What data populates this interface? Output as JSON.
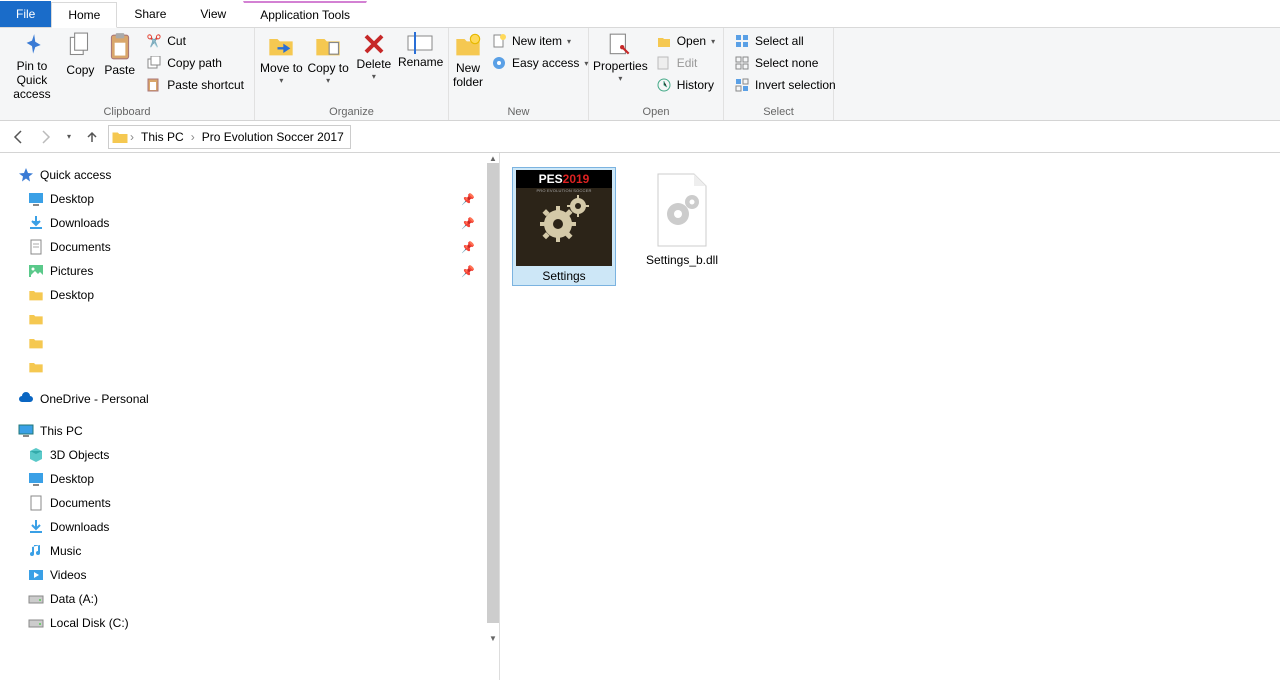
{
  "tabs": {
    "file": "File",
    "home": "Home",
    "share": "Share",
    "view": "View",
    "app_tools": "Application Tools"
  },
  "ribbon": {
    "clipboard": {
      "title": "Clipboard",
      "pin": "Pin to Quick access",
      "copy": "Copy",
      "paste": "Paste",
      "cut": "Cut",
      "copy_path": "Copy path",
      "paste_shortcut": "Paste shortcut"
    },
    "organize": {
      "title": "Organize",
      "move_to": "Move to",
      "copy_to": "Copy to",
      "delete": "Delete",
      "rename": "Rename"
    },
    "new": {
      "title": "New",
      "new_folder": "New folder",
      "new_item": "New item",
      "easy_access": "Easy access"
    },
    "open": {
      "title": "Open",
      "properties": "Properties",
      "open": "Open",
      "edit": "Edit",
      "history": "History"
    },
    "select": {
      "title": "Select",
      "select_all": "Select all",
      "select_none": "Select none",
      "invert": "Invert selection"
    }
  },
  "breadcrumb": {
    "root": "This PC",
    "folder": "Pro Evolution Soccer 2017"
  },
  "sidebar": {
    "quick_access": "Quick access",
    "desktop": "Desktop",
    "downloads": "Downloads",
    "documents": "Documents",
    "pictures": "Pictures",
    "desktop2": "Desktop",
    "onedrive": "OneDrive - Personal",
    "this_pc": "This PC",
    "objects3d": "3D Objects",
    "desktop3": "Desktop",
    "documents2": "Documents",
    "downloads2": "Downloads",
    "music": "Music",
    "videos": "Videos",
    "data_a": "Data (A:)",
    "local_c": "Local Disk (C:)"
  },
  "files": {
    "settings": "Settings",
    "settings_dll": "Settings_b.dll",
    "pes_prefix": "PES",
    "pes_year": "2019",
    "pes_sub": "PRO EVOLUTION SOCCER"
  }
}
